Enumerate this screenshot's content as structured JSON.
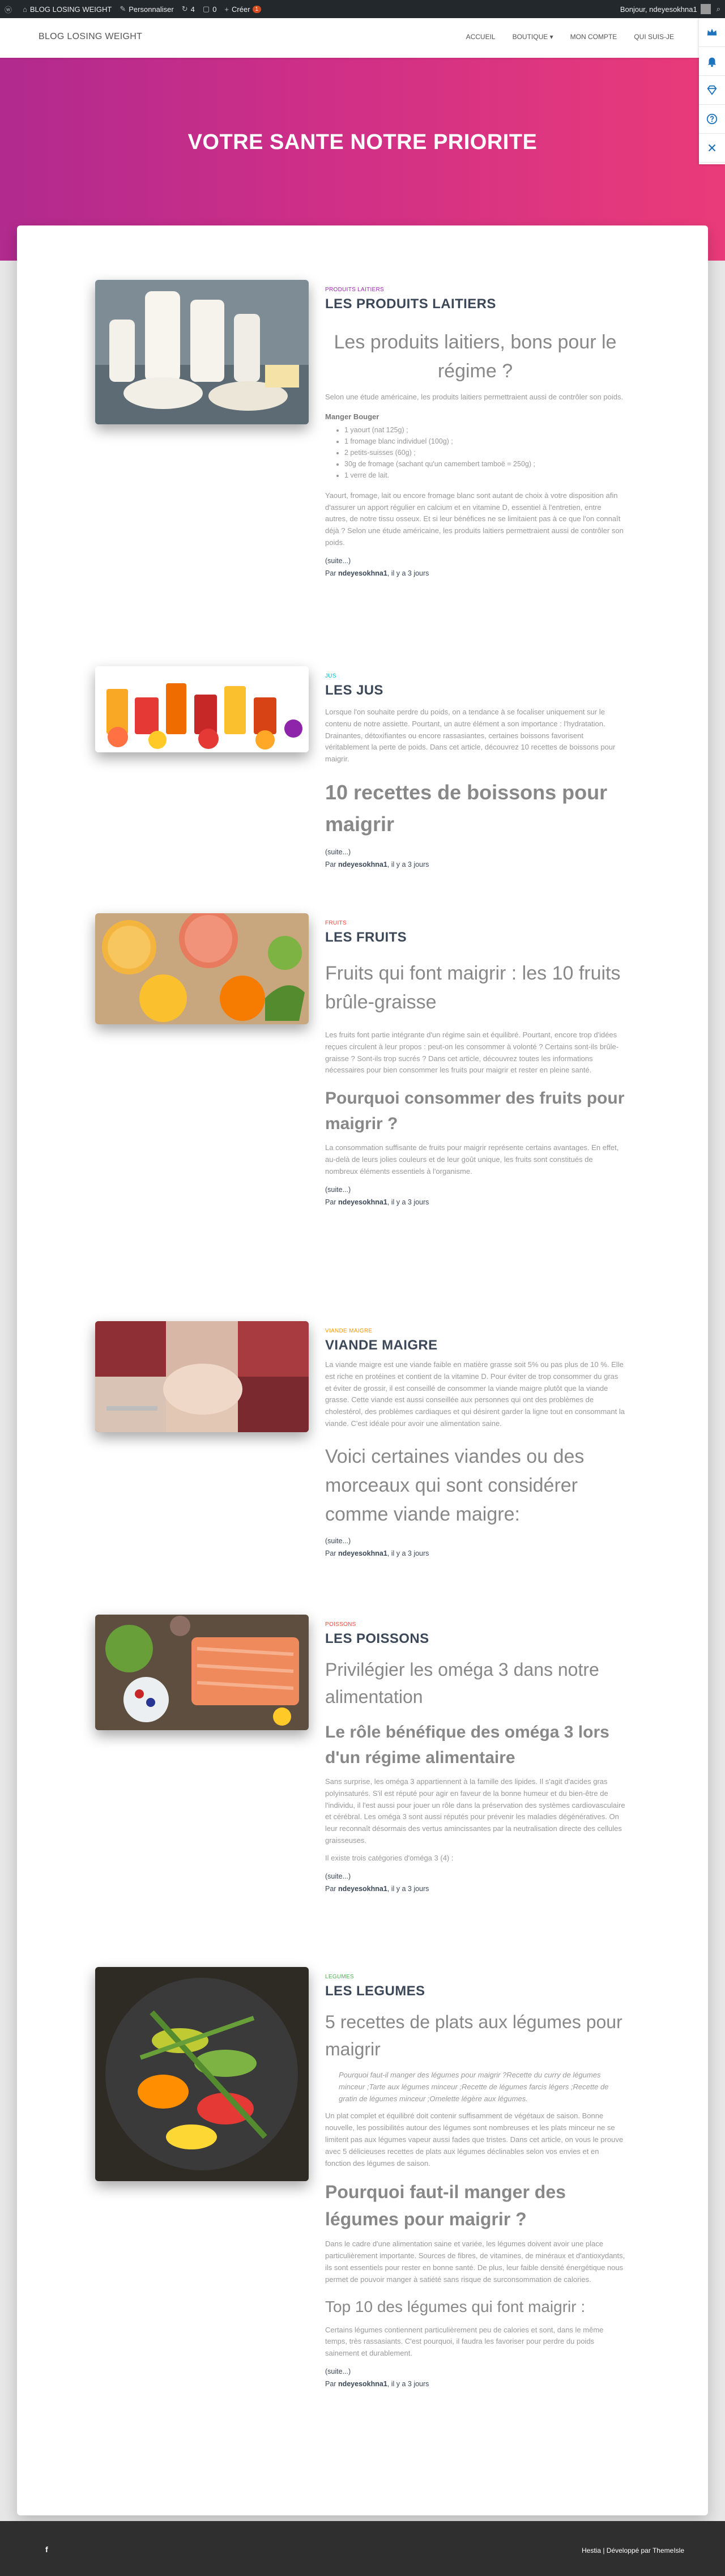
{
  "adminbar": {
    "site": "BLOG LOSING WEIGHT",
    "customize": "Personnaliser",
    "updates": "4",
    "comments": "0",
    "new": "Créer",
    "notif": "1",
    "greeting": "Bonjour, ndeyesokhna1"
  },
  "header": {
    "brand": "BLOG LOSING WEIGHT",
    "nav": [
      "ACCUEIL",
      "BOUTIQUE",
      "MON COMPTE",
      "QUI SUIS-JE"
    ]
  },
  "hero": {
    "title": "VOTRE SANTE NOTRE PRIORITE"
  },
  "colors": {
    "hero_start": "#b12a8e",
    "hero_end": "#ea3b79",
    "title": "#3c4858",
    "footer": "#2f2f2f"
  },
  "posts": [
    {
      "category": "PRODUITS LAITIERS",
      "category_color": "#9c27b0",
      "title": "LES PRODUITS LAITIERS",
      "heading": "Les produits laitiers, bons pour le régime ?",
      "intro": "Selon une étude américaine, les produits laitiers permettraient aussi de contrôler son poids.",
      "subhead": "Manger Bouger",
      "list": [
        "1 yaourt (nat 125g) ;",
        "1 fromage blanc individuel (100g) ;",
        "2 petits-suisses (60g) ;",
        "30g de fromage (sachant qu'un camembert tamboë = 250g) ;",
        "1 verre de lait."
      ],
      "body": "Yaourt, fromage, lait ou encore fromage blanc sont autant de choix à votre disposition afin d'assurer un apport régulier en calcium et en vitamine D, essentiel à l'entretien, entre autres, de notre tissu osseux. Et si leur bénéfices ne se limitaient pas à ce que l'on connaît déjà ? Selon une étude américaine, les produits laitiers permettraient aussi de contrôler son poids.",
      "more": "(suite...)",
      "byline_prefix": "Par",
      "author": "ndeyesokhna1",
      "when": ", il y a 3 jours"
    },
    {
      "category": "JUS",
      "category_color": "#00bcd4",
      "title": "LES JUS",
      "body": "Lorsque l'on souhaite perdre du poids, on a tendance à se focaliser uniquement sur le contenu de notre assiette. Pourtant, un autre élément a son importance : l'hydratation. Drainantes, détoxifiantes ou encore rassasiantes, certaines boissons favorisent véritablement la perte de poids. Dans cet article, découvrez 10 recettes de boissons pour maigrir.",
      "heading": "10 recettes de boissons pour maigrir",
      "more": "(suite...)",
      "byline_prefix": "Par",
      "author": "ndeyesokhna1",
      "when": ", il y a 3 jours"
    },
    {
      "category": "FRUITS",
      "category_color": "#f44336",
      "title": "LES FRUITS",
      "heading": "Fruits qui font maigrir : les 10 fruits brûle-graisse",
      "body": "Les fruits font partie intégrante d'un régime sain et équilibré. Pourtant, encore trop d'idées reçues circulent à leur propos : peut-on les consommer à volonté ? Certains sont-ils brûle-graisse ? Sont-ils trop sucrés ? Dans cet article, découvrez toutes les informations nécessaires pour bien consommer les fruits pour maigrir et rester en pleine santé.",
      "subheading": "Pourquoi consommer des fruits pour maigrir ?",
      "body2": "La consommation suffisante de fruits pour maigrir représente certains avantages. En effet, au-delà de leurs jolies couleurs et de leur goût unique, les fruits sont constitués de nombreux éléments essentiels à l'organisme.",
      "more": "(suite...)",
      "byline_prefix": "Par",
      "author": "ndeyesokhna1",
      "when": ", il y a 3 jours"
    },
    {
      "category": "VIANDE MAIGRE",
      "category_color": "#ff9800",
      "title": "VIANDE MAIGRE",
      "body": "La viande maigre est une viande faible en matière grasse soit 5% ou pas plus de 10 %. Elle est riche en protéines et contient de la vitamine D. Pour éviter de trop consommer du gras et éviter de grossir, il est conseillé de consommer la viande maigre plutôt que la viande grasse. Cette viande est aussi conseillée aux personnes qui ont des problèmes de cholestérol, des problèmes cardiaques et qui désirent garder la ligne tout en consommant la viande. C'est idéale pour avoir une alimentation saine.",
      "heading": "Voici certaines viandes ou des morceaux qui sont considérer comme viande maigre:",
      "more": "(suite...)",
      "byline_prefix": "Par",
      "author": "ndeyesokhna1",
      "when": ", il y a 3 jours"
    },
    {
      "category": "POISSONS",
      "category_color": "#f44336",
      "title": "LES POISSONS",
      "heading": "Privilégier les oméga 3 dans notre alimentation",
      "subheading": "Le rôle bénéfique des oméga 3 lors d'un régime alimentaire",
      "body": "Sans surprise, les oméga 3 appartiennent à la famille des lipides. Il s'agit d'acides gras polyinsaturés. S'il est réputé pour agir en faveur de la bonne humeur et du bien-être de l'individu, il l'est aussi pour jouer un rôle dans la préservation des systèmes cardiovasculaire et cérébral. Les oméga 3 sont aussi réputés pour prévenir les maladies dégénératives. On leur reconnaît désormais des vertus amincissantes par la neutralisation directe des cellules graisseuses.",
      "body2": "Il existe trois catégories d'oméga 3 (4) :",
      "more": "(suite...)",
      "byline_prefix": "Par",
      "author": "ndeyesokhna1",
      "when": ", il y a 3 jours"
    },
    {
      "category": "LEGUMES",
      "category_color": "#4caf50",
      "title": "LES LEGUMES",
      "heading": "5 recettes de plats aux légumes pour maigrir",
      "quote": "Pourquoi faut-il manger des légumes pour maigrir ?Recette du curry de légumes minceur ;Tarte aux légumes minceur ;Recette de légumes farcis légers ;Recette de gratin de légumes minceur ;Omelette légère aux légumes.",
      "body": "Un plat complet et équilibré doit contenir suffisamment de végétaux de saison. Bonne nouvelle, les possibilités autour des légumes sont nombreuses et les plats minceur ne se limitent pas aux légumes vapeur aussi fades que tristes. Dans cet article, on vous le prouve avec 5 délicieuses recettes de plats aux légumes déclinables selon vos envies et en fonction des légumes de saison.",
      "subheading": "Pourquoi faut-il manger des légumes pour maigrir ?",
      "body2": "Dans le cadre d'une alimentation saine et variée, les légumes doivent avoir une place particulièrement importante. Sources de fibres, de vitamines, de minéraux et d'antioxydants, ils sont essentiels pour rester en bonne santé. De plus, leur faible densité énergétique nous permet de pouvoir manger à satiété sans risque de surconsommation de calories.",
      "subheading2": "Top 10 des légumes qui font maigrir :",
      "body3": "Certains légumes contiennent particulièrement peu de calories et sont, dans le même temps, très rassasiants. C'est pourquoi, il faudra les favoriser pour perdre du poids sainement et durablement.",
      "more": "(suite...)",
      "byline_prefix": "Par",
      "author": "ndeyesokhna1",
      "when": ", il y a 3 jours"
    }
  ],
  "footer": {
    "social": "f",
    "site": "Hestia",
    "separator": " | Développé par ",
    "author": "ThemeIsle"
  }
}
